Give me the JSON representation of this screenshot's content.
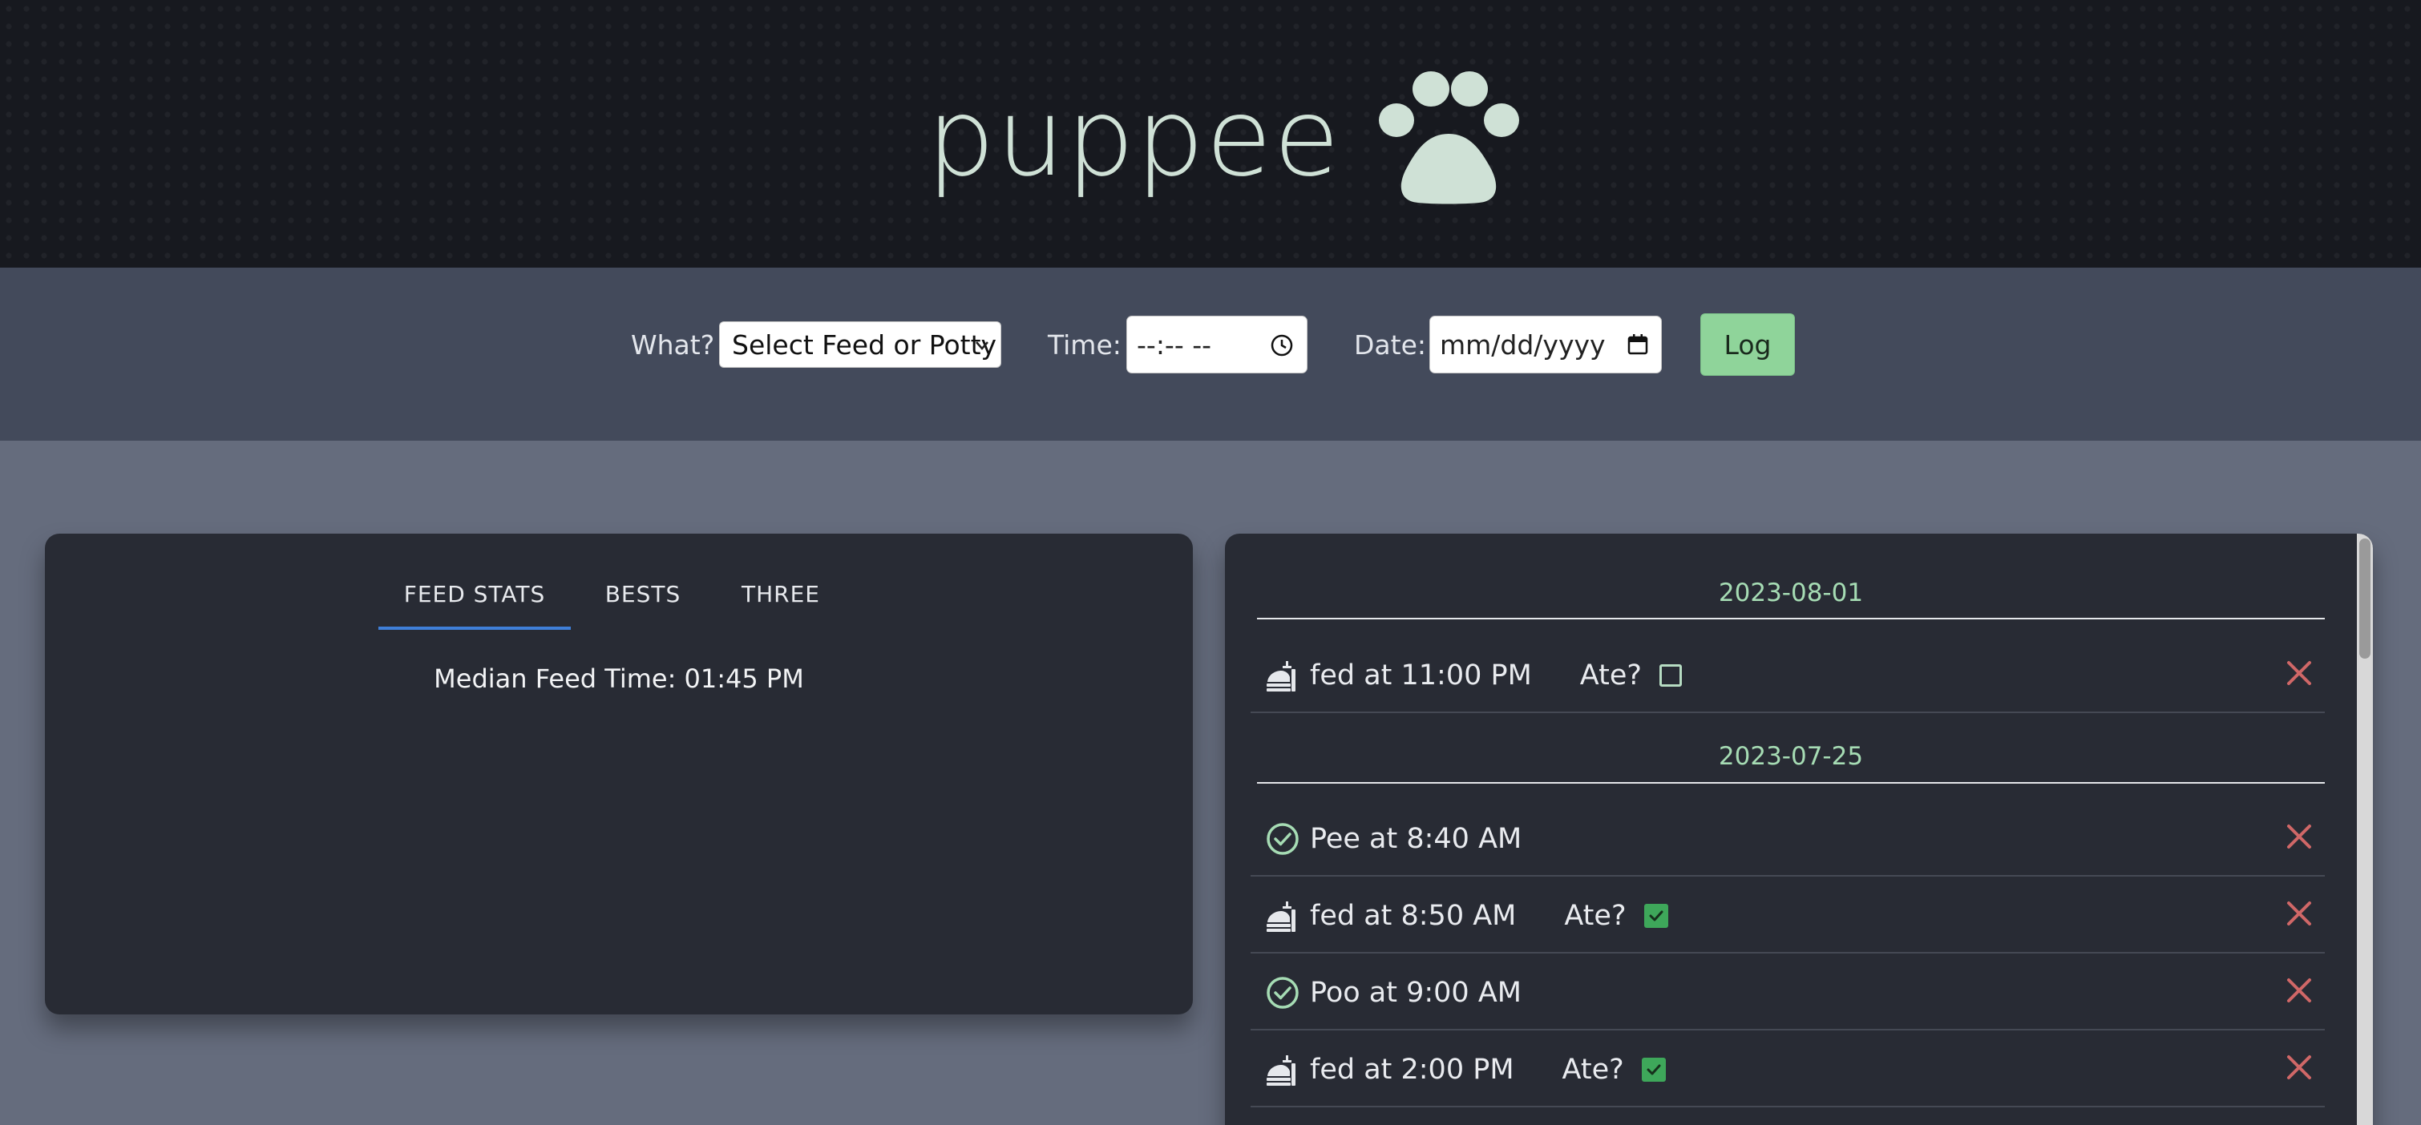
{
  "header": {
    "title": "puppee",
    "logo_icon": "paw-icon"
  },
  "form": {
    "what_label": "What?",
    "what_select": "Select Feed or Potty",
    "time_label": "Time:",
    "time_value": "--:-- --",
    "date_label": "Date:",
    "date_value": "mm/dd/yyyy",
    "log_button": "Log",
    "log_color": "#8fd49a"
  },
  "stats": {
    "tabs": [
      "FEED STATS",
      "BESTS",
      "THREE"
    ],
    "active_tab": "FEED STATS",
    "median": "Median Feed Time: 01:45 PM"
  },
  "log": {
    "days": [
      {
        "date": "2023-08-01",
        "entries": [
          {
            "icon": "food-icon",
            "text": "fed at 11:00 PM",
            "ate_label": "Ate?",
            "ate": false
          }
        ]
      },
      {
        "date": "2023-07-25",
        "entries": [
          {
            "icon": "check-circle-icon",
            "text": "Pee at 8:40 AM"
          },
          {
            "icon": "food-icon",
            "text": "fed at 8:50 AM",
            "ate_label": "Ate?",
            "ate": true
          },
          {
            "icon": "check-circle-icon",
            "text": "Poo at 9:00 AM"
          },
          {
            "icon": "food-icon",
            "text": "fed at 2:00 PM",
            "ate_label": "Ate?",
            "ate": true
          }
        ]
      }
    ],
    "delete_color": "#d06767",
    "date_color": "#a6dcb4"
  }
}
